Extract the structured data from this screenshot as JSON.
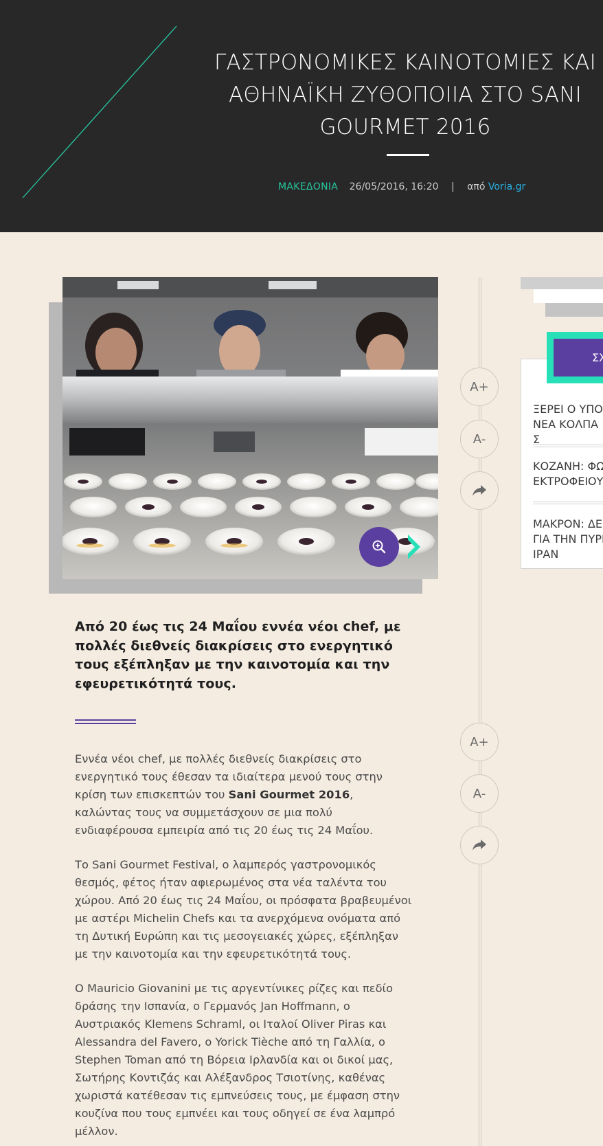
{
  "header": {
    "title": "ΓΑΣΤΡΟΝΟΜΙΚΕΣ ΚΑΙΝΟΤΟΜΙΕΣ ΚΑΙ ΑΘΗΝΑΪΚΗ ΖΥΘΟΠΟΙΙΑ ΣΤΟ SANI GOURMET 2016",
    "category": "ΜΑΚΕΔΟΝΙΑ",
    "date": "26/05/2016, 16:20",
    "separator": "|",
    "source_prefix": "από",
    "source": "Voria.gr"
  },
  "article": {
    "image_icons": {
      "zoom": "zoom-in-icon",
      "next": "chevron-right-icon"
    },
    "lead": "Από 20 έως τις 24 Μαΐου εννέα νέοι chef, με πολλές διεθνείς διακρίσεις στο ενεργητικό τους εξέπληξαν με την καινοτομία και την εφευρετικότητά τους.",
    "p1_before": "Εννέα νέοι chef, με πολλές διεθνείς διακρίσεις στο ενεργητικό τους έθεσαν τα ιδιαίτερα μενού τους στην κρίση των επισκεπτών του ",
    "p1_bold": "Sani Gourmet 2016",
    "p1_after": ", καλώντας τους να συμμετάσχουν σε μια πολύ ενδιαφέρουσα εμπειρία από τις 20 έως τις 24 Μαΐου.",
    "p2": "Το Sani Gourmet Festival, ο λαμπερός γαστρονομικός θεσμός, φέτος ήταν αφιερωμένος στα νέα ταλέντα του χώρου. Από 20 έως τις 24 Μαΐου, οι πρόσφατα βραβευμένοι με αστέρι Michelin Chefs και τα ανερχόμενα ονόματα από τη Δυτική Ευρώπη και τις μεσογειακές χώρες, εξέπληξαν με την καινοτομία και την εφευρετικότητά τους.",
    "p3": "Ο Mauricio Giovanini με τις αργεντίνικες ρίζες και πεδίο δράσης την Ισπανία, ο Γερμανός Jan Hoffmann, ο Αυστριακός Klemens Schraml, οι Ιταλοί Oliver Piras και Alessandra del Favero, ο Yorick Tièche από τη Γαλλία, ο Stephen Toman από τη Βόρεια Ιρλανδία και οι δικοί μας, Σωτήρης Κοντιζάς και Αλέξανδρος Τσιοτίνης, καθένας χωριστά κατέθεσαν τις εμπνεύσεις τους, με έμφαση στην κουζίνα που τους εμπνέει και τους οδηγεί σε ένα λαμπρό μέλλον."
  },
  "tools": {
    "font_increase": "A+",
    "font_decrease": "A-",
    "share_icon": "share-arrow-icon"
  },
  "sidebar": {
    "button_label": "ΣΧ",
    "items": [
      {
        "label": "ΞΕΡΕΙ Ο ΥΠΟ\nΝΕΑ ΚΟΛΠΑ Σ"
      },
      {
        "label": "ΚΟΖΑΝΗ: ΦΩ\nΕΚΤΡΟΦΕΙΟΥ"
      },
      {
        "label": "ΜΑΚΡΟΝ: ΔΕ\nΓΙΑ ΤΗΝ ΠΥΡΙ\nΙΡΑΝ"
      }
    ]
  },
  "colors": {
    "header_bg": "#282828",
    "page_bg": "#f4ece1",
    "accent_teal": "#27c7a0",
    "accent_purple": "#5b3fa0",
    "link_blue": "#27b3e4"
  }
}
